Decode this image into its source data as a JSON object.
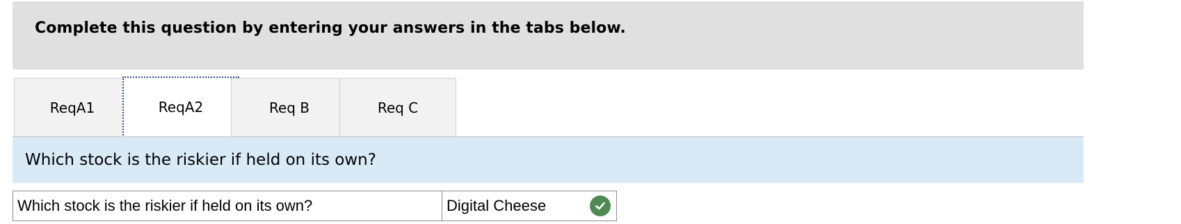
{
  "instruction": {
    "text": "Complete this question by entering your answers in the tabs below."
  },
  "tabs": [
    {
      "label": "ReqA1",
      "active": false
    },
    {
      "label": "ReqA2",
      "active": true
    },
    {
      "label": "Req B",
      "active": false
    },
    {
      "label": "Req C",
      "active": false
    }
  ],
  "question": {
    "prompt": "Which stock is the riskier if held on its own?"
  },
  "answer_table": {
    "rows": [
      {
        "question": "Which stock is the riskier if held on its own?",
        "answer": "Digital Cheese",
        "status_icon": "check-circle-icon",
        "status_color": "#4f8a55"
      }
    ]
  },
  "colors": {
    "instruction_bg": "#e0e0e0",
    "question_bg": "#d9eaf7",
    "tab_bg": "#f2f2f2",
    "active_tab_border": "#2a4d8f"
  }
}
